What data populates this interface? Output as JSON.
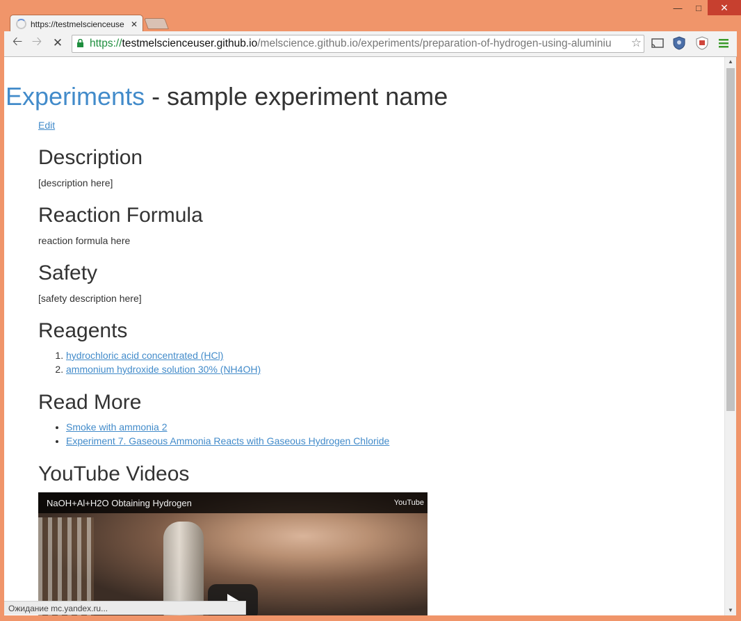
{
  "browser": {
    "tab_title": "https://testmelscienceuser.github.io/melscience.github.io/experiments/preparation-of-hydrogen-using-aluminium",
    "tab_title_short": "https://testmelscienceuse",
    "url_scheme": "https://",
    "url_host": "testmelscienceuser.github.io",
    "url_path": "/melscience.github.io/experiments/preparation-of-hydrogen-using-aluminiu",
    "status_text": "Ожидание mc.yandex.ru...",
    "accent_colors": {
      "frame": "#f0956a",
      "close": "#c7402f",
      "link": "#428bca"
    }
  },
  "page": {
    "breadcrumb_link": "Experiments",
    "title_rest": " - sample experiment name",
    "edit_link": "Edit",
    "sections": {
      "description": {
        "heading": "Description",
        "text": "[description here]"
      },
      "formula": {
        "heading": "Reaction Formula",
        "text": "reaction formula here"
      },
      "safety": {
        "heading": "Safety",
        "text": "[safety description here]"
      },
      "reagents": {
        "heading": "Reagents",
        "items": [
          "hydrochloric acid concentrated (HCl)",
          "ammonium hydroxide solution 30% (NH4OH)"
        ]
      },
      "read_more": {
        "heading": "Read More",
        "items": [
          "Smoke with ammonia 2",
          "Experiment 7. Gaseous Ammonia Reacts with Gaseous Hydrogen Chloride"
        ]
      },
      "videos": {
        "heading": "YouTube Videos",
        "video_title": "NaOH+Al+H2O Obtaining Hydrogen",
        "provider": "YouTube"
      }
    }
  }
}
